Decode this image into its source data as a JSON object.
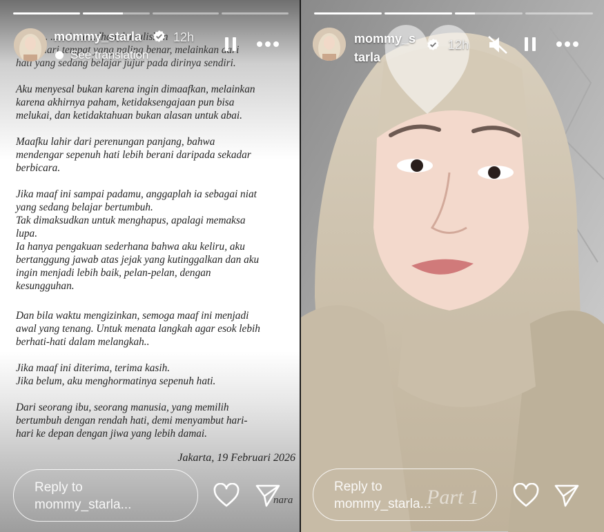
{
  "left_story": {
    "progress": [
      1,
      0.6,
      0,
      0
    ],
    "username": "mommy_starla",
    "time": "12h",
    "see_translation": "See translation",
    "letter_top_line1": "...lan ... ... ...i ...a...dhan, ku tuliskan",
    "letter_top_line2": "...kan dari tempat yang paling benar, melainkan dari",
    "letter_top_line3": "hati yang sedang belajar jujur pada dirinya sendiri.",
    "paragraphs": [
      "Aku menyesal bukan karena ingin dimaafkan, melainkan\nkarena akhirnya paham, ketidaksengajaan pun bisa\nmelukai, dan ketidaktahuan bukan alasan untuk abai.",
      "Maafku lahir dari perenungan panjang, bahwa\nmendengar sepenuh hati lebih berani daripada sekadar\nberbicara.",
      "Jika maaf ini sampai padamu, anggaplah ia sebagai niat\nyang sedang belajar bertumbuh.\nTak dimaksudkan untuk menghapus, apalagi memaksa\nlupa.\nIa hanya pengakuan sederhana bahwa aku keliru, aku\nbertanggung jawab atas jejak yang kutinggalkan dan aku\ningin menjadi lebih baik, pelan-pelan, dengan\nkesungguhan.",
      "Dan bila waktu mengizinkan, semoga maaf ini menjadi\nawal yang tenang. Untuk menata langkah agar esok lebih\nberhati-hati dalam melangkah..",
      "Jika maaf ini diterima, terima kasih.\nJika belum, aku menghormatinya sepenuh hati.",
      "Dari seorang ibu, seorang manusia, yang memilih\nbertumbuh dengan rendah hati, demi menyambut hari-\nhari ke depan dengan jiwa yang lebih damai."
    ],
    "dateline": "Jakarta, 19 Februari 2026",
    "signature": "nara",
    "reply_placeholder": "Reply to\nmommy_starla..."
  },
  "right_story": {
    "progress": [
      1,
      1,
      0.3,
      0
    ],
    "username_line1": "mommy_s",
    "username_line2": "tarla",
    "time": "12h",
    "overlay_text": "Part 1",
    "reply_placeholder": "Reply to\nmommy_starla..."
  },
  "colors": {
    "text_white": "#ffffff",
    "letter_ink": "#222222",
    "hijab": "#cfc4b1"
  },
  "icons": [
    "verified-badge-icon",
    "pause-icon",
    "more-icon",
    "mute-icon",
    "heart-icon",
    "send-icon",
    "heart-sticker-icon"
  ]
}
